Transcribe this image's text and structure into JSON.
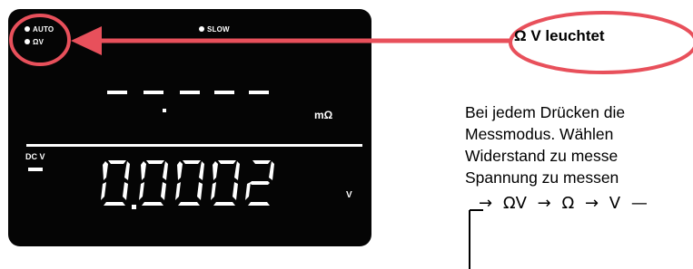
{
  "display": {
    "indicator_auto": "AUTO",
    "indicator_omega_v": "ΩV",
    "indicator_slow": "SLOW",
    "upper_reading": "-.----",
    "upper_unit": "mΩ",
    "lower_label": "DC V",
    "lower_sign": "–",
    "lower_reading": "0.0002",
    "lower_unit": "V"
  },
  "callout": {
    "label": "Ω V leuchtet"
  },
  "description": {
    "lines": [
      "Bei jedem Drücken die",
      "Messmodus. Wählen",
      "Widerstand zu messe",
      "Spannung zu messen"
    ]
  },
  "cycle": {
    "steps": [
      "ΩV",
      "Ω",
      "V"
    ]
  },
  "colors": {
    "accent": "#e8505b",
    "lcd_background": "#050505",
    "segment": "#ffffff"
  },
  "icons": {
    "arrow": "left-arrow-icon",
    "cycle_arrow": "right-arrow-icon",
    "return_path": "loop-back-icon"
  }
}
